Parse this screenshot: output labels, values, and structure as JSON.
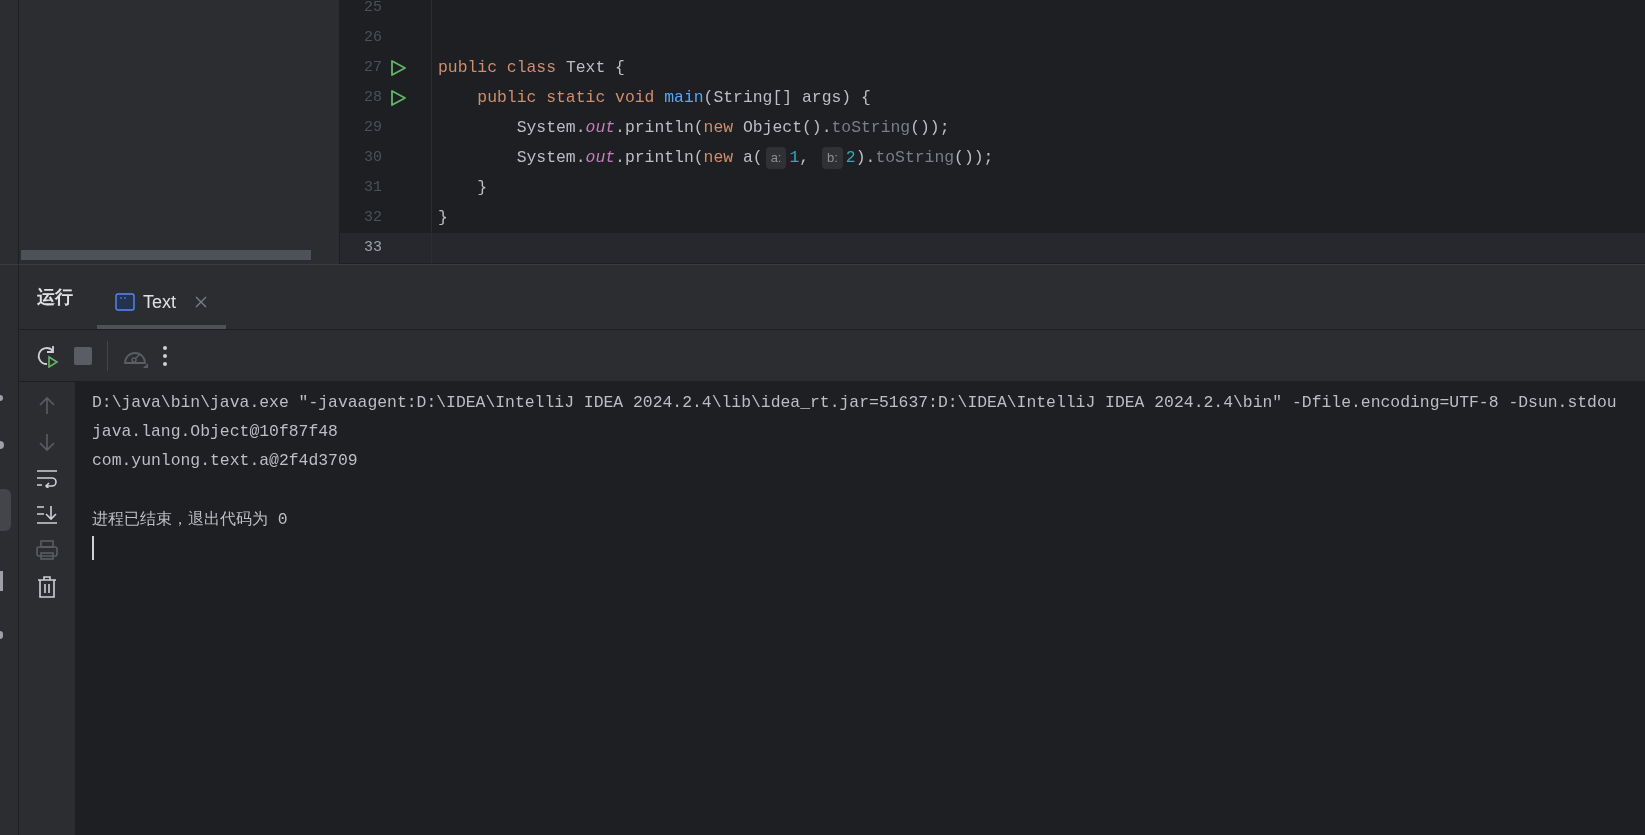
{
  "editor": {
    "lines": [
      {
        "number": "25",
        "run_marker": false,
        "current": false
      },
      {
        "number": "26",
        "run_marker": false,
        "current": false
      },
      {
        "number": "27",
        "run_marker": true,
        "current": false,
        "tokens": [
          {
            "kind": "keyword",
            "text": "public class "
          },
          {
            "kind": "plain",
            "text": "Text {"
          }
        ]
      },
      {
        "number": "28",
        "run_marker": true,
        "current": false,
        "tokens": [
          {
            "kind": "keyword",
            "text": "    public static void "
          },
          {
            "kind": "method",
            "text": "main"
          },
          {
            "kind": "plain",
            "text": "(String[] args) {"
          }
        ]
      },
      {
        "number": "29",
        "run_marker": false,
        "current": false,
        "tokens": [
          {
            "kind": "plain",
            "text": "        System."
          },
          {
            "kind": "field",
            "text": "out"
          },
          {
            "kind": "plain",
            "text": ".println("
          },
          {
            "kind": "keyword",
            "text": "new "
          },
          {
            "kind": "plain",
            "text": "Object()."
          },
          {
            "kind": "muted",
            "text": "toString"
          },
          {
            "kind": "plain",
            "text": "());"
          }
        ]
      },
      {
        "number": "30",
        "run_marker": false,
        "current": false,
        "tokens": [
          {
            "kind": "plain",
            "text": "        System."
          },
          {
            "kind": "field",
            "text": "out"
          },
          {
            "kind": "plain",
            "text": ".println("
          },
          {
            "kind": "keyword",
            "text": "new "
          },
          {
            "kind": "plain",
            "text": "a("
          },
          {
            "kind": "hint",
            "text": "a:"
          },
          {
            "kind": "number",
            "text": "1"
          },
          {
            "kind": "plain",
            "text": ", "
          },
          {
            "kind": "hint",
            "text": "b:"
          },
          {
            "kind": "number",
            "text": "2"
          },
          {
            "kind": "plain",
            "text": ")."
          },
          {
            "kind": "muted",
            "text": "toString"
          },
          {
            "kind": "plain",
            "text": "());"
          }
        ]
      },
      {
        "number": "31",
        "run_marker": false,
        "current": false,
        "tokens": [
          {
            "kind": "plain",
            "text": "    }"
          }
        ]
      },
      {
        "number": "32",
        "run_marker": false,
        "current": false,
        "tokens": [
          {
            "kind": "plain",
            "text": "}"
          }
        ]
      },
      {
        "number": "33",
        "run_marker": false,
        "current": true
      }
    ]
  },
  "run_panel": {
    "title": "运行",
    "tabs": [
      {
        "label": "Text",
        "selected": true
      }
    ],
    "toolbar": [
      {
        "kind": "rerun",
        "disabled": false
      },
      {
        "kind": "stop",
        "disabled": true
      },
      {
        "kind": "separator"
      },
      {
        "kind": "profiler",
        "disabled": true
      },
      {
        "kind": "more",
        "disabled": false
      }
    ],
    "side_actions": [
      {
        "kind": "up",
        "disabled": true
      },
      {
        "kind": "down",
        "disabled": true
      },
      {
        "kind": "wrap",
        "disabled": false
      },
      {
        "kind": "scroll-end",
        "disabled": false
      },
      {
        "kind": "print",
        "disabled": true
      },
      {
        "kind": "delete",
        "disabled": false
      }
    ],
    "console": {
      "lines": [
        {
          "kind": "command",
          "text": "D:\\java\\bin\\java.exe \"-javaagent:D:\\IDEA\\IntelliJ IDEA 2024.2.4\\lib\\idea_rt.jar=51637:D:\\IDEA\\IntelliJ IDEA 2024.2.4\\bin\" -Dfile.encoding=UTF-8 -Dsun.stdou"
        },
        {
          "kind": "output",
          "text": "java.lang.Object@10f87f48"
        },
        {
          "kind": "output",
          "text": "com.yunlong.text.a@2f4d3709"
        },
        {
          "kind": "status",
          "text": "进程已结束，退出代码为 0"
        }
      ]
    }
  }
}
